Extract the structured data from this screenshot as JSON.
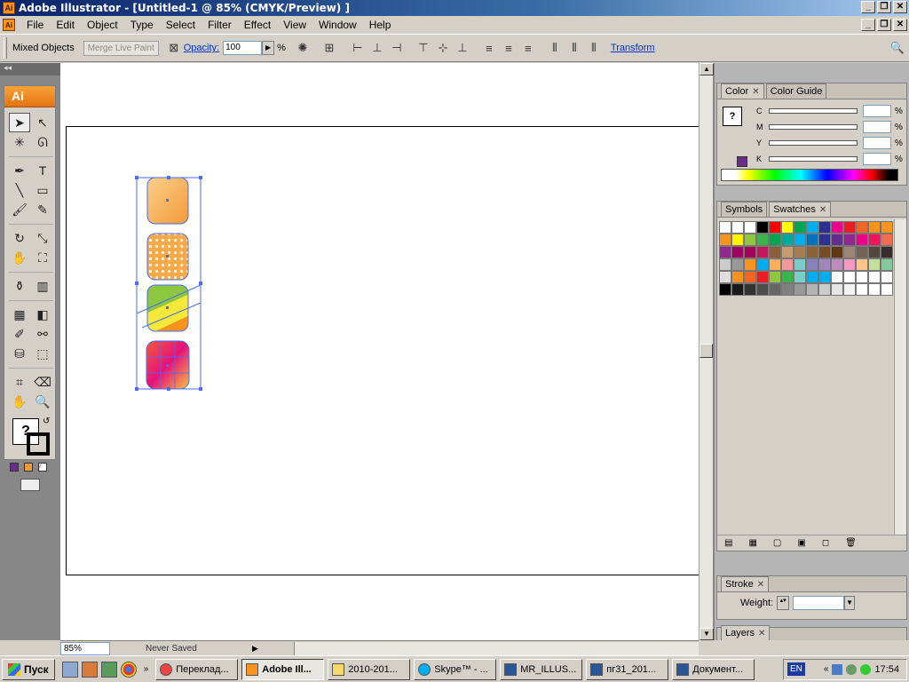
{
  "window": {
    "title": "Adobe Illustrator - [Untitled-1 @ 85% (CMYK/Preview) ]",
    "app_icon": "Ai",
    "minimize": "_",
    "restore": "❐",
    "close": "✕"
  },
  "menubar": {
    "items": [
      "File",
      "Edit",
      "Object",
      "Type",
      "Select",
      "Filter",
      "Effect",
      "View",
      "Window",
      "Help"
    ]
  },
  "controlbar": {
    "selection_label": "Mixed Objects",
    "merge_button": "Merge Live Paint",
    "opacity_label": "Opacity:",
    "opacity_value": "100",
    "opacity_unit": "%",
    "transform_link": "Transform"
  },
  "toolbox": {
    "logo": "Ai"
  },
  "color_panel": {
    "tabs": [
      "Color",
      "Color Guide"
    ],
    "channels": [
      "C",
      "M",
      "Y",
      "K"
    ],
    "percent": "%",
    "fill_color": "#6b2d8a"
  },
  "swatches_panel": {
    "tabs": [
      "Symbols",
      "Swatches"
    ],
    "rows": [
      [
        "#ffffff",
        "#ffffff",
        "#ffffff",
        "#000000",
        "#ff0000",
        "#ffff00",
        "#00a651",
        "#00aeef",
        "#2e3192",
        "#ec008c",
        "#ed1c24",
        "#f26522",
        "#f7941d",
        "#f7941d"
      ],
      [
        "#f7941d",
        "#fff200",
        "#8dc63f",
        "#39b54a",
        "#00a651",
        "#00a99d",
        "#00aeef",
        "#0072bc",
        "#2e3192",
        "#662d91",
        "#92278f",
        "#ec008c",
        "#ed145b",
        "#f26c4f"
      ],
      [
        "#92278f",
        "#9e005d",
        "#a3005a",
        "#c2185b",
        "#8b5e3c",
        "#c69c6d",
        "#a67c52",
        "#8c6239",
        "#754c24",
        "#603913",
        "#998675",
        "#736357",
        "#534741",
        "#362f2d"
      ],
      [
        "#cccccc",
        "#999999",
        "#f7941d",
        "#00aeef",
        "#fbaf5d",
        "#f5989d",
        "#7accc8",
        "#8781bd",
        "#a186be",
        "#bd8cbf",
        "#f49ac1",
        "#fdc689",
        "#c4df9b",
        "#82ca9c"
      ],
      [
        "#e0e0e0",
        "#f7941d",
        "#f26522",
        "#ed1c24",
        "#8dc63f",
        "#39b54a",
        "#7accc8",
        "#00aeef",
        "#00aeef",
        "#ffffff",
        "#ffffff",
        "#ffffff",
        "#ffffff",
        "#ffffff"
      ],
      [
        "#000000",
        "#1a1a1a",
        "#333333",
        "#4d4d4d",
        "#666666",
        "#808080",
        "#999999",
        "#b3b3b3",
        "#cccccc",
        "#e6e6e6",
        "#f2f2f2",
        "#ffffff",
        "#ffffff",
        "#ffffff"
      ]
    ]
  },
  "stroke_panel": {
    "tab": "Stroke",
    "weight_label": "Weight:"
  },
  "layers_panel": {
    "tab": "Layers"
  },
  "statusbar": {
    "zoom": "85%",
    "status": "Never Saved"
  },
  "taskbar": {
    "start": "Пуск",
    "tasks": [
      "Переклад...",
      "Adobe Ill...",
      "2010-201...",
      "Skype™ - ...",
      "MR_ILLUS...",
      "пг31_201...",
      "Документ..."
    ],
    "language": "EN",
    "clock": "17:54"
  }
}
